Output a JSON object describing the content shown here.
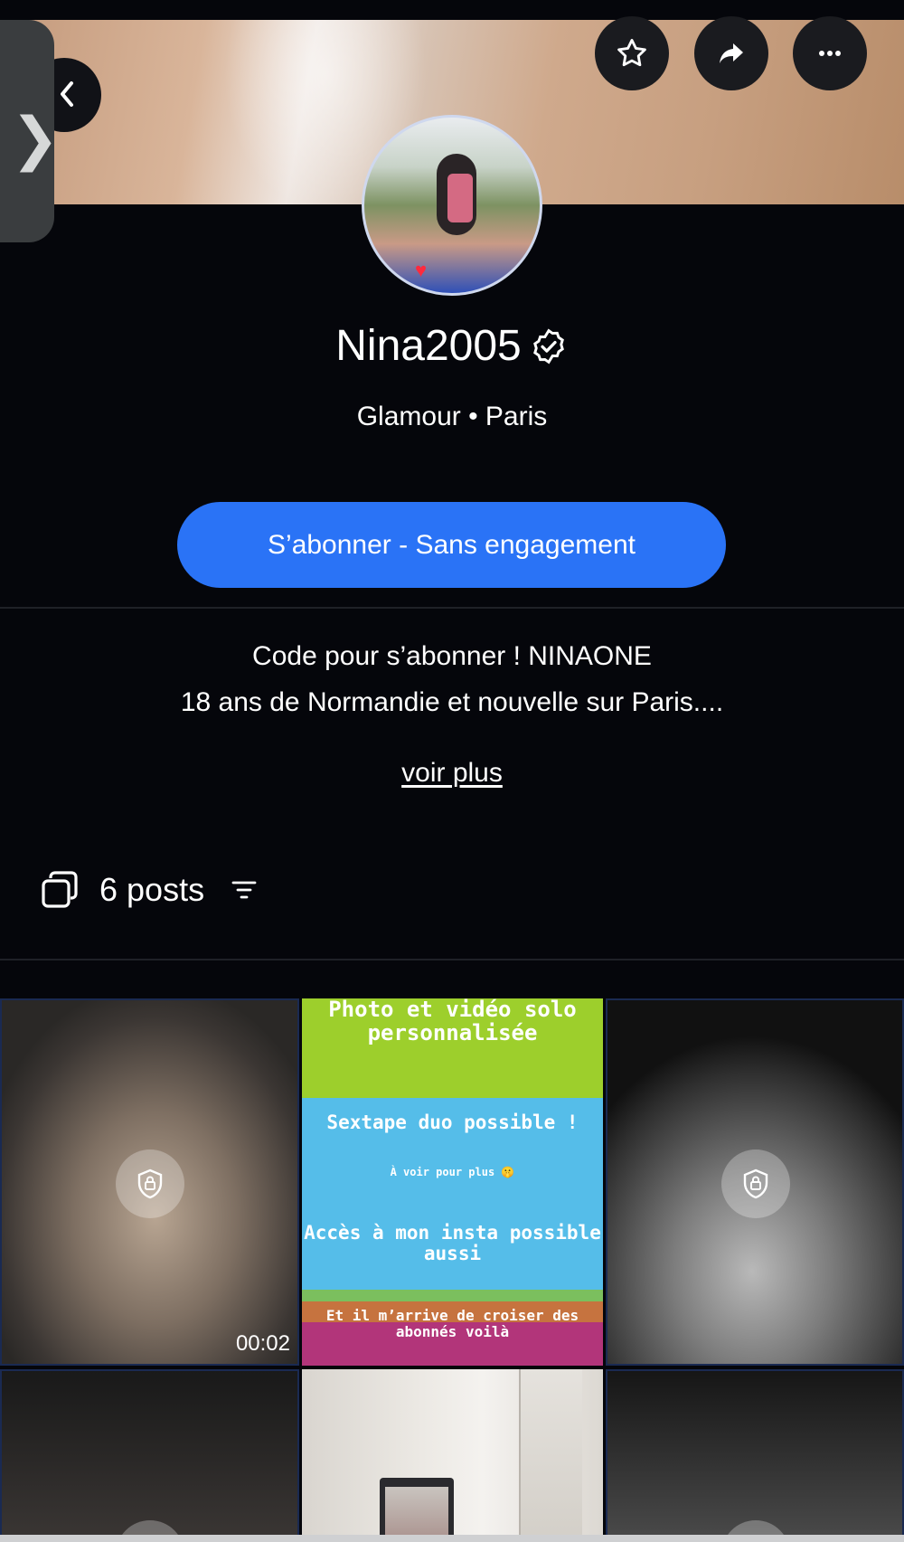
{
  "profile": {
    "name": "Nina2005",
    "subtitle": "Glamour • Paris"
  },
  "actions": {
    "subscribe_label": "S’abonner - Sans engagement"
  },
  "bio": {
    "line1": "Code pour s’abonner ! NINAONE",
    "line2": "18 ans de Normandie et nouvelle sur Paris....",
    "see_more": "voir plus"
  },
  "posts": {
    "count_label": "6 posts"
  },
  "grid": {
    "tile1_duration": "00:02",
    "promo": {
      "line1": "Photo et vidéo solo personnalisée",
      "line2": "Sextape duo possible !",
      "line3": "À voir pour plus 🤫",
      "line4": "Accès à mon insta possible aussi",
      "line5": "Et il m’arrive de croiser des abonnés voilà"
    }
  },
  "colors": {
    "background": "#05060b",
    "accent": "#2a73f6",
    "text": "#ffffff"
  },
  "icons": [
    "back-icon",
    "star-icon",
    "share-icon",
    "more-icon",
    "verified-icon",
    "posts-icon",
    "filter-icon",
    "lock-icon"
  ]
}
